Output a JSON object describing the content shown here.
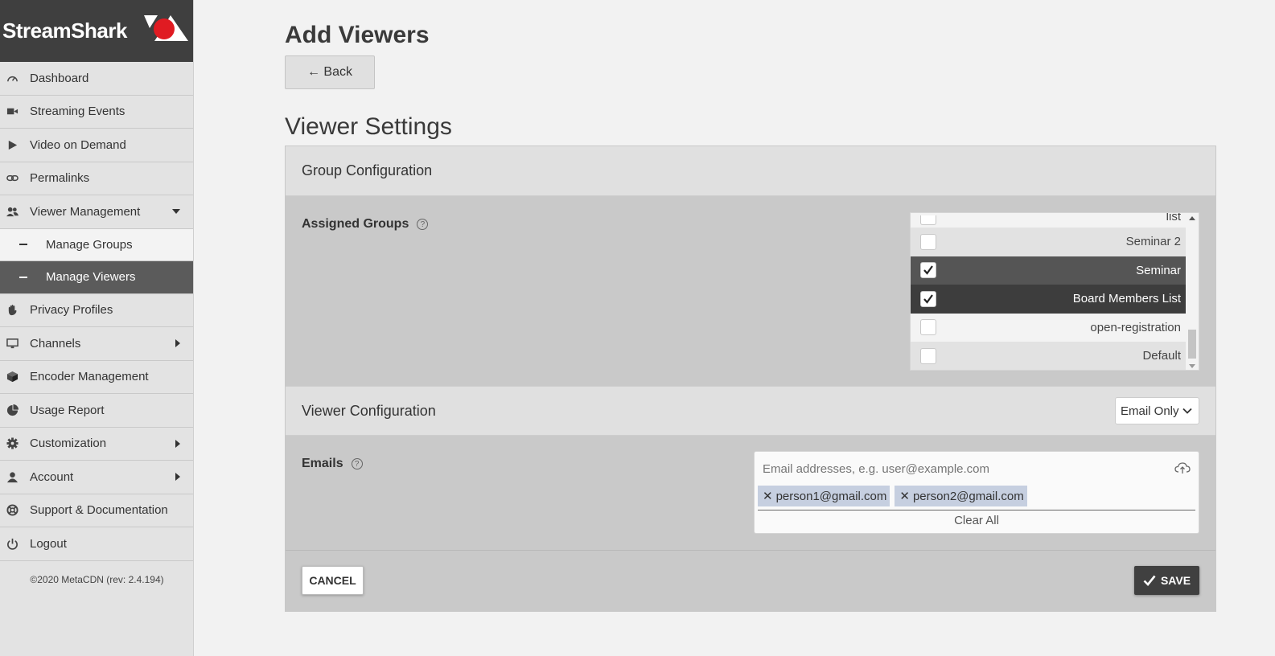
{
  "brand": {
    "name": "StreamShark",
    "logo_color": "#e01b22"
  },
  "sidebar": {
    "items": [
      {
        "label": "Dashboard",
        "icon": "gauge-icon"
      },
      {
        "label": "Streaming Events",
        "icon": "video-camera-icon"
      },
      {
        "label": "Video on Demand",
        "icon": "play-icon"
      },
      {
        "label": "Permalinks",
        "icon": "link-icon"
      },
      {
        "label": "Viewer Management",
        "icon": "users-icon",
        "expanded": true
      }
    ],
    "sub_items": [
      {
        "label": "Manage Groups"
      },
      {
        "label": "Manage Viewers",
        "active": true
      }
    ],
    "items_after": [
      {
        "label": "Privacy Profiles",
        "icon": "hand-icon"
      },
      {
        "label": "Channels",
        "icon": "monitor-icon",
        "has_submenu": true
      },
      {
        "label": "Encoder Management",
        "icon": "cube-icon"
      },
      {
        "label": "Usage Report",
        "icon": "pie-chart-icon"
      },
      {
        "label": "Customization",
        "icon": "gear-icon",
        "has_submenu": true
      },
      {
        "label": "Account",
        "icon": "user-icon",
        "has_submenu": true
      },
      {
        "label": "Support & Documentation",
        "icon": "lifebuoy-icon"
      },
      {
        "label": "Logout",
        "icon": "power-icon"
      }
    ],
    "copyright": "©2020 MetaCDN (rev: 2.4.194)"
  },
  "page": {
    "title": "Add Viewers",
    "back_label": "← Back",
    "section_title": "Viewer Settings"
  },
  "group_config": {
    "header": "Group Configuration",
    "assigned_label": "Assigned Groups",
    "help": "?",
    "groups": [
      {
        "name": "list",
        "checked": false
      },
      {
        "name": "Seminar 2",
        "checked": false
      },
      {
        "name": "Seminar",
        "checked": true
      },
      {
        "name": "Board Members List",
        "checked": true
      },
      {
        "name": "open-registration",
        "checked": false
      },
      {
        "name": "Default",
        "checked": false
      }
    ]
  },
  "viewer_config": {
    "header": "Viewer Configuration",
    "mode_selected": "Email Only",
    "emails_label": "Emails",
    "help": "?",
    "email_placeholder": "Email addresses, e.g. user@example.com",
    "emails": [
      "person1@gmail.com",
      "person2@gmail.com"
    ],
    "clear_all": "Clear All"
  },
  "footer": {
    "cancel_label": "CANCEL",
    "save_label": "SAVE"
  }
}
